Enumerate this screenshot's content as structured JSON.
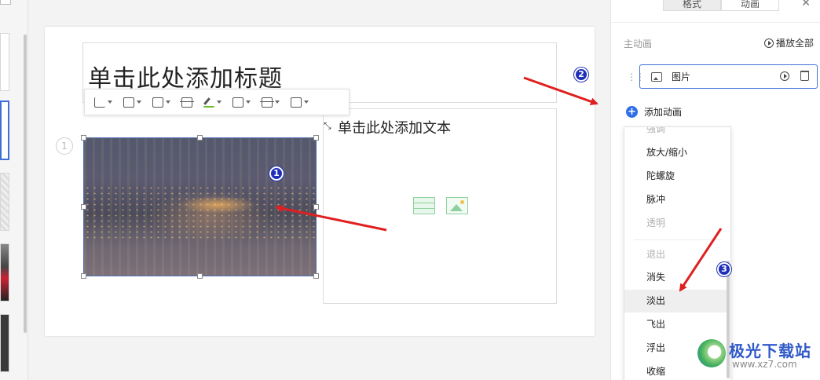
{
  "slide": {
    "title_placeholder": "单击此处添加标题",
    "content_placeholder": "单击此处添加文本",
    "content_number": "1"
  },
  "badges": {
    "one": "1",
    "two": "2",
    "three": "3"
  },
  "right_panel": {
    "tabs": [
      "格式",
      "动画"
    ],
    "active_tab": "动画",
    "close_icon": "close-icon",
    "section_title": "主动画",
    "play_all_label": "播放全部",
    "animation_item": {
      "icon": "image-icon",
      "label": "图片"
    },
    "add_animation_label": "添加动画"
  },
  "dropdown": {
    "items": [
      {
        "label": "强调",
        "muted": true
      },
      {
        "label": "放大/缩小",
        "muted": false
      },
      {
        "label": "陀螺旋",
        "muted": false
      },
      {
        "label": "脉冲",
        "muted": false
      },
      {
        "label": "透明",
        "muted": true
      },
      {
        "label": "退出",
        "muted": true
      },
      {
        "label": "消失",
        "muted": false
      },
      {
        "label": "淡出",
        "muted": false,
        "hover": true
      },
      {
        "label": "飞出",
        "muted": false
      },
      {
        "label": "浮出",
        "muted": false
      },
      {
        "label": "收缩",
        "muted": false
      }
    ]
  },
  "floating_toolbar": {
    "tools": [
      "crop-icon",
      "image-icon",
      "image-adjust-icon",
      "align-icon",
      "pen-icon",
      "border-icon",
      "layer-icon",
      "more-icon"
    ]
  },
  "watermark": {
    "title": "极光下载站",
    "url": "www.xz7.com"
  },
  "colors": {
    "accent": "#2f6ee8",
    "arrow": "#e02020",
    "badge": "#1f2fb8",
    "selection": "#3e6fd6"
  }
}
